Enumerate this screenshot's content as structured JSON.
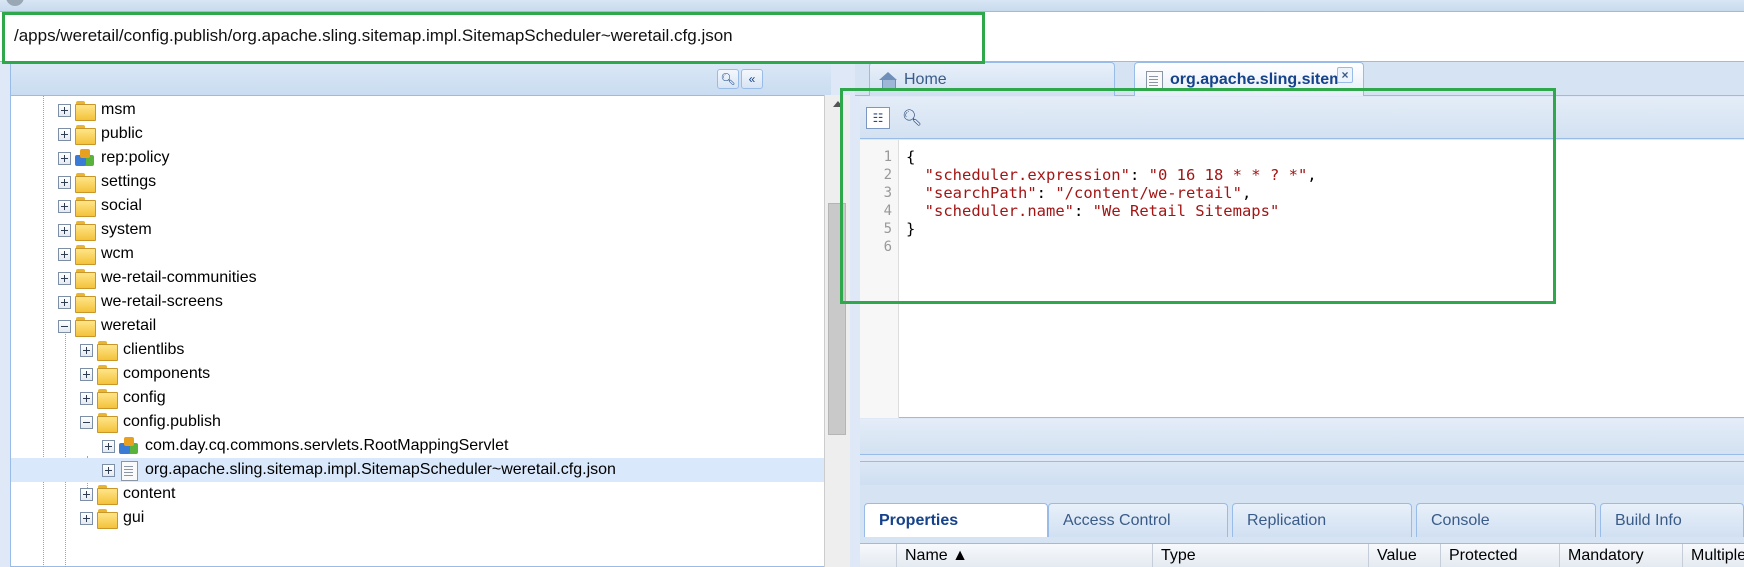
{
  "path_value": "/apps/weretail/config.publish/org.apache.sling.sitemap.impl.SitemapScheduler~weretail.cfg.json",
  "tree": {
    "items": [
      {
        "label": "msm",
        "icon": "folder-icon"
      },
      {
        "label": "public",
        "icon": "folder-icon"
      },
      {
        "label": "rep:policy",
        "icon": "policy-icon"
      },
      {
        "label": "settings",
        "icon": "folder-icon"
      },
      {
        "label": "social",
        "icon": "folder-icon"
      },
      {
        "label": "system",
        "icon": "folder-icon"
      },
      {
        "label": "wcm",
        "icon": "folder-icon"
      },
      {
        "label": "we-retail-communities",
        "icon": "folder-icon"
      },
      {
        "label": "we-retail-screens",
        "icon": "folder-icon"
      },
      {
        "label": "weretail",
        "icon": "folder-icon"
      },
      {
        "label": "clientlibs",
        "icon": "folder-icon"
      },
      {
        "label": "components",
        "icon": "folder-icon"
      },
      {
        "label": "config",
        "icon": "folder-icon"
      },
      {
        "label": "config.publish",
        "icon": "folder-icon"
      },
      {
        "label": "com.day.cq.commons.servlets.RootMappingServlet",
        "icon": "policy-icon"
      },
      {
        "label": "org.apache.sling.sitemap.impl.SitemapScheduler~weretail.cfg.json",
        "icon": "file-icon"
      },
      {
        "label": "content",
        "icon": "folder-icon"
      },
      {
        "label": "gui",
        "icon": "folder-icon"
      }
    ]
  },
  "tabs": {
    "home": "Home",
    "file": "org.apache.sling.sitemap",
    "close": "×"
  },
  "editor": {
    "line_numbers": [
      "1",
      "2",
      "3",
      "4",
      "5",
      "6"
    ],
    "line1": "{",
    "line2_key": "\"scheduler.expression\"",
    "line2_val": "\"0 16 18 * * ? *\"",
    "line3_key": "\"searchPath\"",
    "line3_val": "\"/content/we-retail\"",
    "line4_key": "\"scheduler.name\"",
    "line4_val": "\"We Retail Sitemaps\"",
    "line5": "}"
  },
  "properties_tabs": [
    "Properties",
    "Access Control",
    "Replication",
    "Console",
    "Build Info"
  ],
  "grid_columns": [
    "Name ▲",
    "Type",
    "Value",
    "Protected",
    "Mandatory",
    "Multiple"
  ],
  "colors": {
    "highlight": "#2ea84a",
    "accent": "#15428b"
  }
}
